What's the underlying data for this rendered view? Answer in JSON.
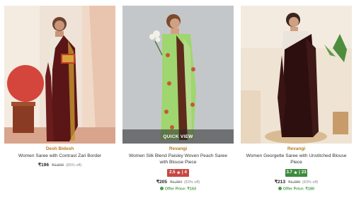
{
  "products": [
    {
      "brand": "Desh Bidesh",
      "title": "Women Saree with Contrast Zari Border",
      "price": "₹196",
      "mrp": "₹1,500",
      "discount": "(85% off)"
    },
    {
      "brand": "Revangi",
      "title": "Women Silk Blend Paisley Woven Peach Saree with Blouse Piece",
      "rating": "2.5",
      "rating_count": "4",
      "rating_star": "★",
      "price": "₹205",
      "mrp": "₹1,284",
      "discount": "(83% off)",
      "offer": "Offer Price: ₹163",
      "quick_view": "QUICK VIEW"
    },
    {
      "brand": "Revangi",
      "title": "Women Georgette Saree with Unstitched Blouse Piece",
      "rating": "3.7",
      "rating_count": "23",
      "rating_star": "★",
      "price": "₹213",
      "mrp": "₹1,280",
      "discount": "(83% off)",
      "offer": "Offer Price: ₹180"
    }
  ],
  "colors": {
    "brand": "#b5791d",
    "rating_low": "#c74843",
    "rating_high": "#3c8a3e",
    "offer": "#4a9b4b"
  }
}
